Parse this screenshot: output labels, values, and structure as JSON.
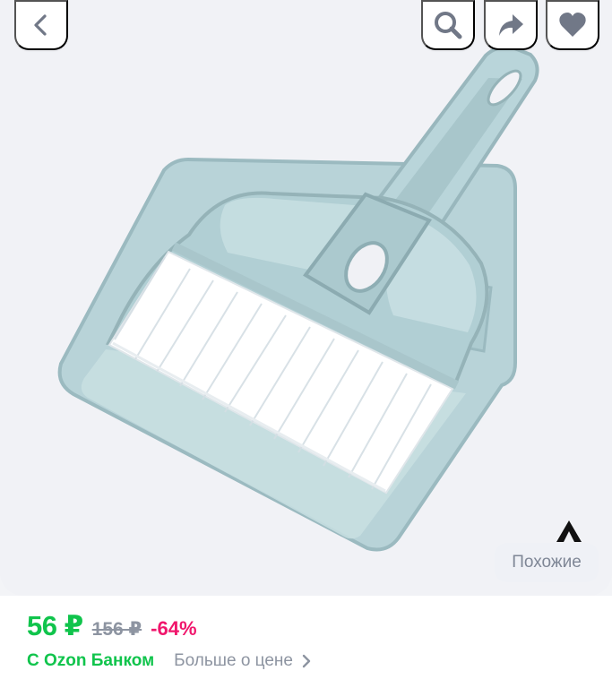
{
  "header": {
    "back_icon": "chevron-left-icon",
    "search_icon": "search-icon",
    "share_icon": "share-icon",
    "favorite_icon": "heart-icon"
  },
  "gallery": {
    "similar_label": "Похожие",
    "image_subject": "brush-and-dustpan"
  },
  "price": {
    "current": "56 ₽",
    "old": "156 ₽",
    "discount": "-64%"
  },
  "links": {
    "bank_price": "С Ozon Банком",
    "more_about_price": "Больше о цене",
    "more_icon": "chevron-right-icon"
  },
  "colors": {
    "price_green": "#10c44c",
    "discount_pink": "#f0166c",
    "muted_gray": "#8d94a1",
    "icon_gray": "#717887"
  }
}
